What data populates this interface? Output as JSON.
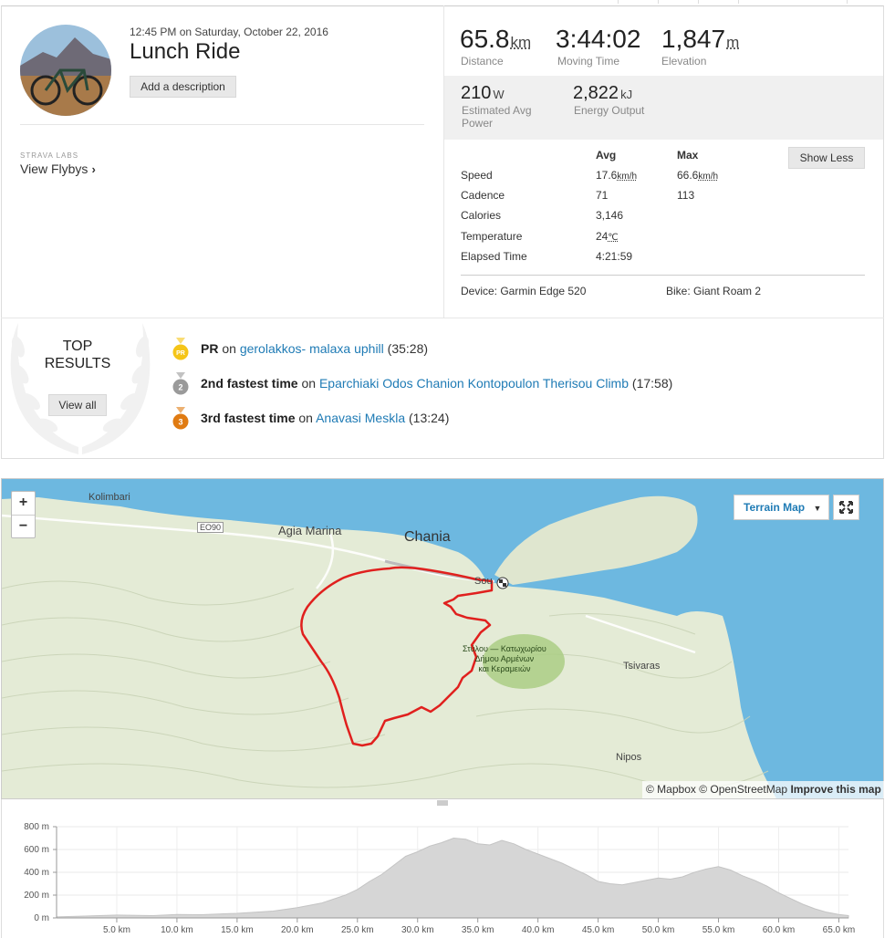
{
  "activity": {
    "datetime": "12:45 PM on Saturday, October 22, 2016",
    "title": "Lunch Ride",
    "add_description": "Add a description",
    "labs_label": "STRAVA LABS",
    "flybys": "View Flybys"
  },
  "stats": {
    "distance": {
      "value": "65.8",
      "unit": "km",
      "label": "Distance"
    },
    "moving_time": {
      "value": "3:44:02",
      "label": "Moving Time"
    },
    "elevation": {
      "value": "1,847",
      "unit": "m",
      "label": "Elevation"
    },
    "power": {
      "value": "210",
      "unit": "W",
      "label_line1": "Estimated Avg",
      "label_line2": "Power"
    },
    "energy": {
      "value": "2,822",
      "unit": "kJ",
      "label": "Energy Output"
    }
  },
  "details": {
    "avg_header": "Avg",
    "max_header": "Max",
    "show_less": "Show Less",
    "rows": [
      {
        "label": "Speed",
        "avg": "17.6",
        "avg_unit": "km/h",
        "max": "66.6",
        "max_unit": "km/h"
      },
      {
        "label": "Cadence",
        "avg": "71",
        "max": "113"
      },
      {
        "label": "Calories",
        "avg": "3,146"
      },
      {
        "label": "Temperature",
        "avg": "24",
        "avg_unit": "℃"
      },
      {
        "label": "Elapsed Time",
        "avg": "4:21:59"
      }
    ],
    "device": "Device: Garmin Edge 520",
    "bike": "Bike: Giant Roam 2"
  },
  "top_results": {
    "title_line1": "TOP",
    "title_line2": "RESULTS",
    "view_all": "View all",
    "efforts": [
      {
        "rank": "PR",
        "rank_label": "PR",
        "segment": "gerolakkos- malaxa uphill",
        "time": "(35:28)",
        "color": "#f5c518"
      },
      {
        "rank": "2",
        "rank_label": "2nd fastest time",
        "segment": "Eparchiaki Odos Chanion Kontopoulon Therisou Climb",
        "time": "(17:58)",
        "color": "#9a9a9a"
      },
      {
        "rank": "3",
        "rank_label": "3rd fastest time",
        "segment": "Anavasi Meskla",
        "time": "(13:24)",
        "color": "#e07b12"
      }
    ],
    "on_word": "on"
  },
  "map": {
    "zoom_in": "+",
    "zoom_out": "−",
    "type_button": "Terrain Map",
    "attribution": "© Mapbox © OpenStreetMap",
    "improve": "Improve this map",
    "labels": {
      "kolimbari": "Kolimbari",
      "eo90": "EO90",
      "agia_marina": "Agia Marina",
      "chania": "Chania",
      "souda": "Sou",
      "park_line1": "Στύλου — Κατωχωρίου",
      "park_line2": "Δήμου Αρμένων",
      "park_line3": "και Κεραμειών",
      "tsivaras": "Tsivaras",
      "nipos": "Nipos"
    },
    "colors": {
      "sea": "#6db8e0",
      "land": "#e6ecd9",
      "route": "#e0201e"
    }
  },
  "chart_data": {
    "type": "area",
    "y_ticks": [
      "800 m",
      "600 m",
      "400 m",
      "200 m",
      "0 m"
    ],
    "ylim": [
      0,
      800
    ],
    "x_ticks": [
      "5.0 km",
      "10.0 km",
      "15.0 km",
      "20.0 km",
      "25.0 km",
      "30.0 km",
      "35.0 km",
      "40.0 km",
      "45.0 km",
      "50.0 km",
      "55.0 km",
      "60.0 km",
      "65.0 km"
    ],
    "xlim": [
      0,
      65.8
    ],
    "x": [
      0,
      2,
      5,
      8,
      10,
      12,
      15,
      18,
      20,
      22,
      24,
      25,
      26,
      27,
      28,
      29,
      30,
      31,
      32,
      33,
      34,
      35,
      36,
      37,
      38,
      39,
      40,
      41,
      42,
      43,
      44,
      45,
      46,
      47,
      48,
      49,
      50,
      51,
      52,
      53,
      54,
      55,
      56,
      57,
      58,
      59,
      60,
      61,
      62,
      63,
      64,
      65,
      65.8
    ],
    "y": [
      10,
      15,
      25,
      20,
      30,
      28,
      40,
      60,
      90,
      130,
      200,
      250,
      320,
      380,
      460,
      540,
      580,
      630,
      660,
      700,
      690,
      650,
      640,
      680,
      650,
      600,
      560,
      520,
      480,
      430,
      380,
      320,
      300,
      290,
      310,
      330,
      350,
      340,
      360,
      400,
      430,
      450,
      420,
      370,
      330,
      280,
      220,
      170,
      120,
      80,
      50,
      30,
      20
    ],
    "fill_color": "#d6d6d6",
    "grid": true
  }
}
